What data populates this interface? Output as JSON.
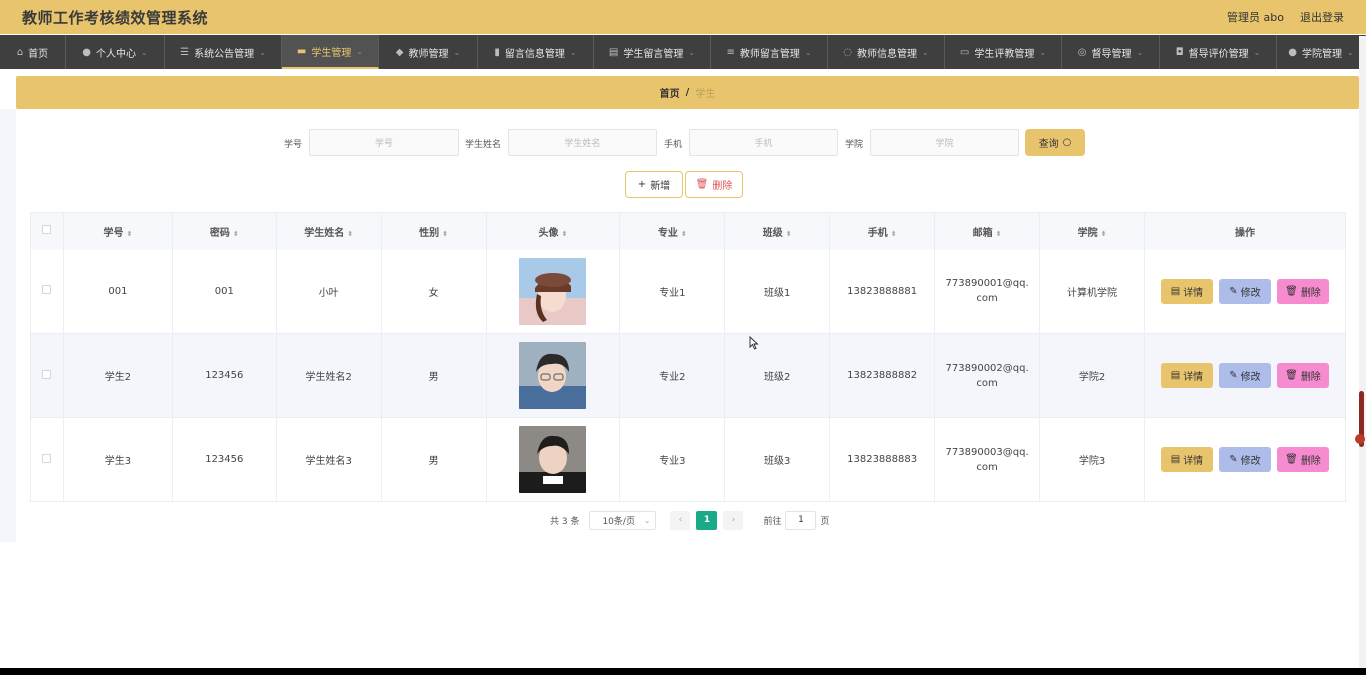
{
  "app": {
    "title": "教师工作考核绩效管理系统",
    "admin_label": "管理员 abo",
    "logout": "退出登录"
  },
  "nav": [
    {
      "label": "首页",
      "icon": "home-icon",
      "glyph": "⌂",
      "caret": ""
    },
    {
      "label": "个人中心",
      "icon": "user-icon",
      "glyph": "●",
      "caret": "⌄"
    },
    {
      "label": "系统公告管理",
      "icon": "sliders-icon",
      "glyph": "☰",
      "caret": "⌄"
    },
    {
      "label": "学生管理",
      "icon": "chat-icon",
      "glyph": "▬",
      "caret": "⌄"
    },
    {
      "label": "教师管理",
      "icon": "location-icon",
      "glyph": "◆",
      "caret": "⌄"
    },
    {
      "label": "留言信息管理",
      "icon": "bar-chart-icon",
      "glyph": "▮",
      "caret": "⌄"
    },
    {
      "label": "学生留言管理",
      "icon": "clipboard-icon",
      "glyph": "▤",
      "caret": "⌄"
    },
    {
      "label": "教师留言管理",
      "icon": "list-icon",
      "glyph": "≡",
      "caret": "⌄"
    },
    {
      "label": "教师信息管理",
      "icon": "power-icon",
      "glyph": "◌",
      "caret": "⌄"
    },
    {
      "label": "学生评教管理",
      "icon": "box-icon",
      "glyph": "▭",
      "caret": "⌄"
    },
    {
      "label": "督导管理",
      "icon": "globe-icon",
      "glyph": "◎",
      "caret": "⌄"
    },
    {
      "label": "督导评价管理",
      "icon": "camera-icon",
      "glyph": "◘",
      "caret": "⌄"
    },
    {
      "label": "学院管理",
      "icon": "person-icon",
      "glyph": "●",
      "caret": "⌄"
    }
  ],
  "breadcrumb": {
    "home": "首页",
    "sep": "/",
    "current": "学生"
  },
  "search": {
    "fields": [
      {
        "label": "学号",
        "placeholder": "学号"
      },
      {
        "label": "学生姓名",
        "placeholder": "学生姓名"
      },
      {
        "label": "手机",
        "placeholder": "手机"
      },
      {
        "label": "学院",
        "placeholder": "学院"
      }
    ],
    "button": "查询",
    "button_icon": "○"
  },
  "actions": {
    "add": "新增",
    "add_icon": "+",
    "delete": "删除",
    "delete_icon": "🗑"
  },
  "table": {
    "columns": [
      "学号",
      "密码",
      "学生姓名",
      "性别",
      "头像",
      "专业",
      "班级",
      "手机",
      "邮箱",
      "学院",
      "操作"
    ],
    "sort_icon": "⬍",
    "rows": [
      {
        "id": "001",
        "password": "001",
        "name": "小叶",
        "gender": "女",
        "major": "专业1",
        "class": "班级1",
        "phone": "13823888881",
        "email": "773890001@qq.com",
        "college": "计算机学院"
      },
      {
        "id": "学生2",
        "password": "123456",
        "name": "学生姓名2",
        "gender": "男",
        "major": "专业2",
        "class": "班级2",
        "phone": "13823888882",
        "email": "773890002@qq.com",
        "college": "学院2"
      },
      {
        "id": "学生3",
        "password": "123456",
        "name": "学生姓名3",
        "gender": "男",
        "major": "专业3",
        "class": "班级3",
        "phone": "13823888883",
        "email": "773890003@qq.com",
        "college": "学院3"
      }
    ],
    "ops": {
      "detail": "详情",
      "edit": "修改",
      "delete": "删除",
      "detail_icon": "▤",
      "edit_icon": "✎",
      "delete_icon": "🗑"
    }
  },
  "pagination": {
    "total": "共 3 条",
    "page_size": "10条/页",
    "current": "1",
    "prev": "‹",
    "next": "›",
    "goto_label": "前往",
    "goto_value": "1",
    "page_suffix": "页"
  }
}
